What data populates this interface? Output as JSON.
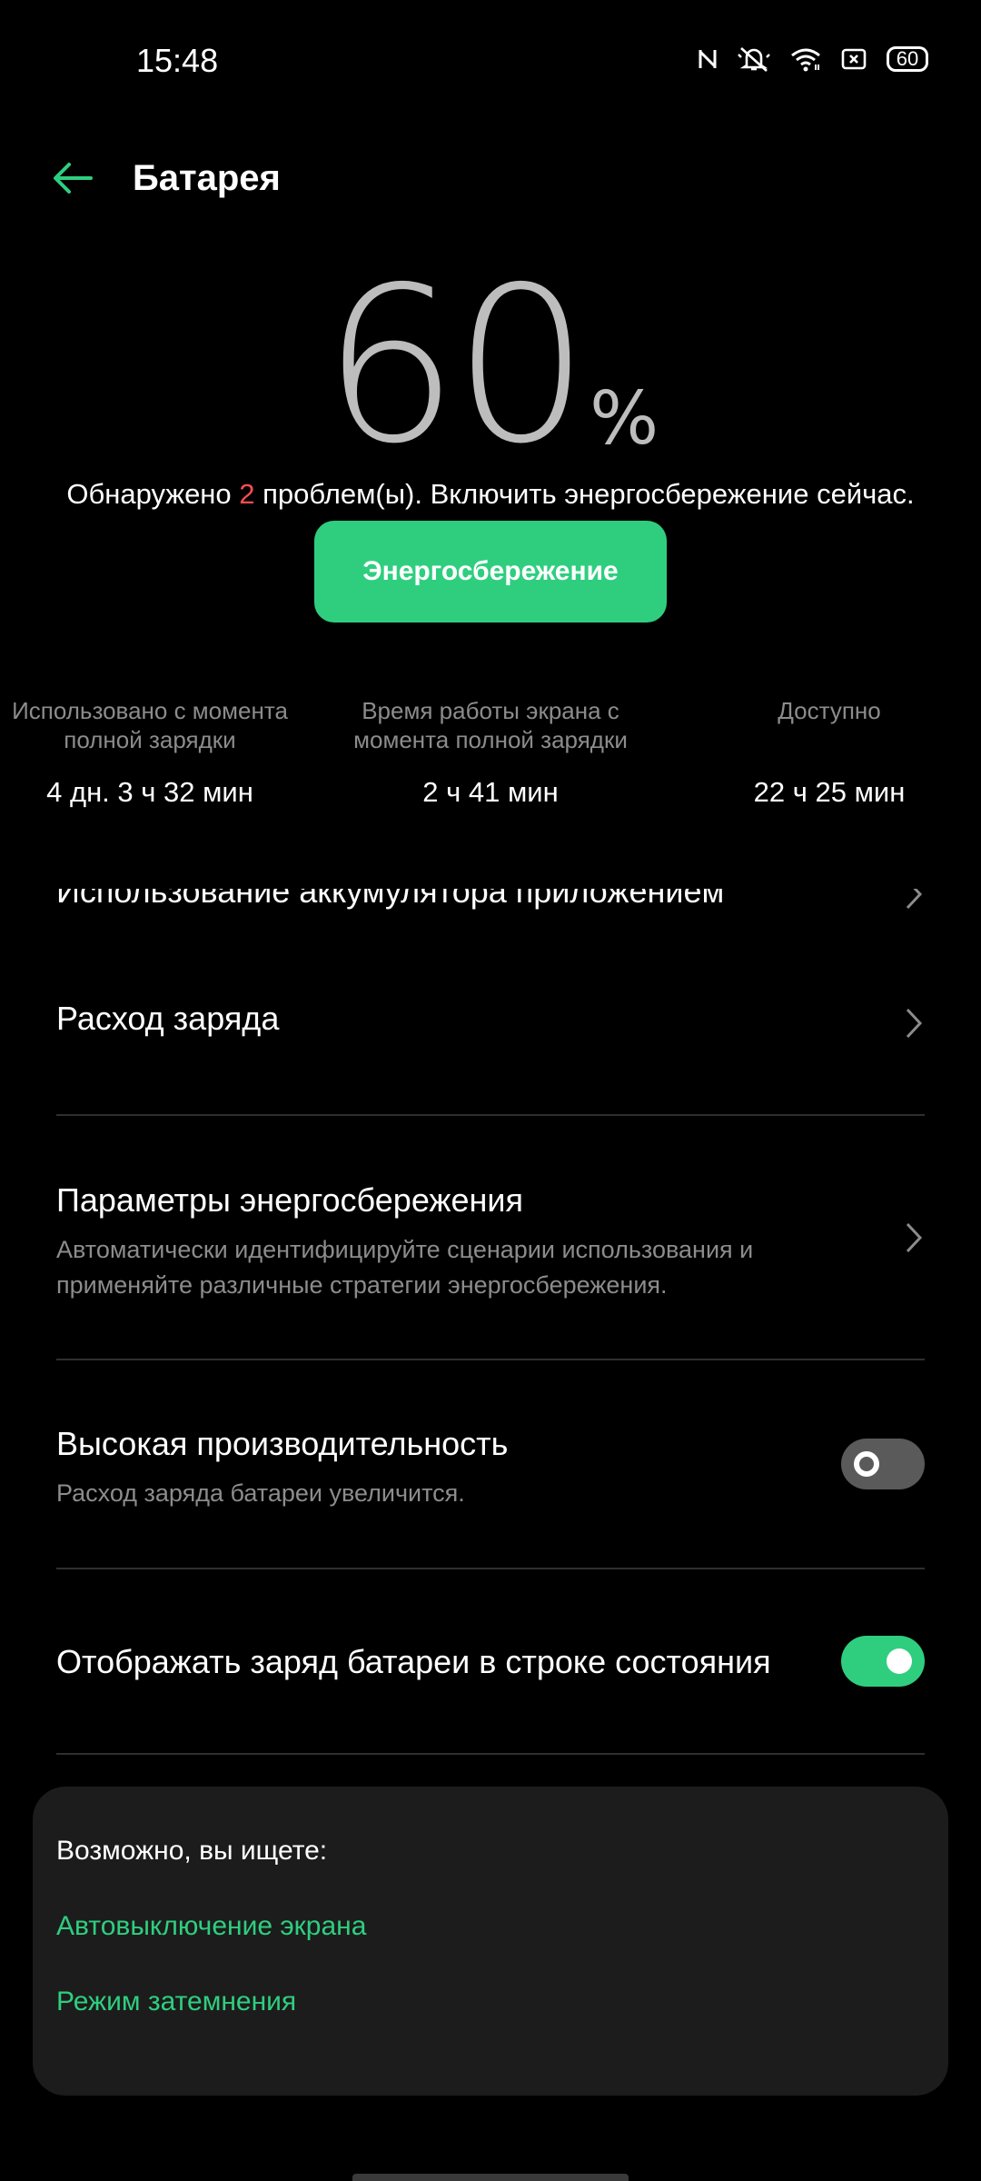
{
  "status_bar": {
    "time": "15:48",
    "battery_level": "60",
    "icons": [
      "nfc-icon",
      "mute-icon",
      "wifi-icon",
      "screenshot-icon",
      "battery-icon"
    ]
  },
  "header": {
    "title": "Батарея"
  },
  "battery": {
    "percent": "60",
    "percent_sign": "%",
    "problems_prefix": "Обнаружено ",
    "problems_count": "2",
    "problems_suffix": " проблем(ы). Включить энергосбережение сейчас.",
    "saver_button": "Энергосбережение"
  },
  "stats": [
    {
      "label": "Использовано с момента полной зарядки",
      "value": "4 дн. 3 ч 32 мин"
    },
    {
      "label": "Время работы экрана с момента полной зарядки",
      "value": "2 ч 41 мин"
    },
    {
      "label": "Доступно",
      "value": "22 ч 25 мин"
    }
  ],
  "list": {
    "partial_item": "Использование аккумулятора приложением",
    "items": [
      {
        "title": "Расход заряда"
      },
      {
        "title": "Параметры энергосбережения",
        "subtitle": "Автоматически идентифицируйте сценарии использования и применяйте различные стратегии энергосбережения."
      },
      {
        "title": "Высокая производительность",
        "subtitle": "Расход заряда батареи увеличится.",
        "toggle": "off"
      },
      {
        "title": "Отображать заряд батареи в строке состояния",
        "toggle": "on"
      }
    ]
  },
  "suggestions": {
    "title": "Возможно, вы ищете:",
    "links": [
      "Автовыключение экрана",
      "Режим затемнения"
    ]
  },
  "colors": {
    "accent": "#2fce7f",
    "warning": "#ff4d4f",
    "background": "#000000",
    "card": "#1c1c1c"
  }
}
